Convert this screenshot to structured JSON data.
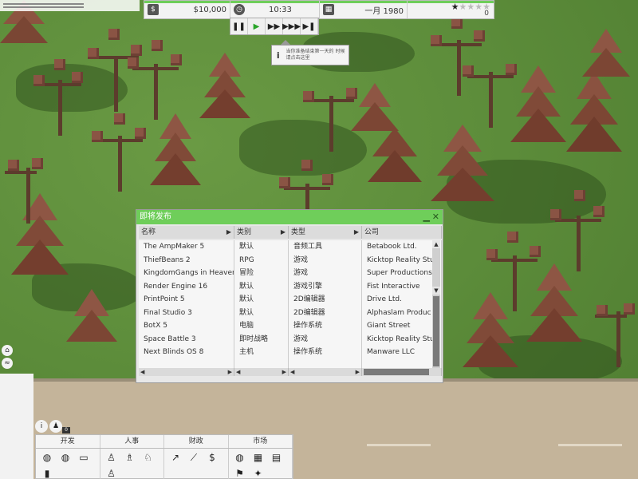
{
  "hud": {
    "money": "$10,000",
    "time": "10:33",
    "date": "一月 1980",
    "star_count": "0",
    "stars_filled": 1,
    "stars_total": 5,
    "icons": {
      "money": "money-icon",
      "clock": "clock-icon",
      "calendar": "calendar-icon",
      "star": "star-icon"
    }
  },
  "speed": {
    "buttons": [
      "pause-icon",
      "play-icon",
      "fast-forward-icon",
      "faster-forward-icon",
      "skip-icon"
    ],
    "glyphs": [
      "❚❚",
      "▶",
      "▶▶",
      "▶▶▶",
      "▶❚"
    ]
  },
  "tooltip": {
    "icon": "i",
    "text": "当你准备结束第一天的 时候请点击这里"
  },
  "releases_window": {
    "title": "即将发布",
    "min_icon": "minimize-icon",
    "close_icon": "close-icon",
    "columns": [
      "名称",
      "类别",
      "类型",
      "公司"
    ],
    "rows": [
      {
        "name": "The AmpMaker 5",
        "category": "默认",
        "type": "音频工具",
        "company": "Betabook Ltd."
      },
      {
        "name": "ThiefBeans 2",
        "category": "RPG",
        "type": "游戏",
        "company": "Kicktop Reality Stu"
      },
      {
        "name": "KingdomGangs in Heaven",
        "category": "冒险",
        "type": "游戏",
        "company": "Super Productions"
      },
      {
        "name": "Render Engine 16",
        "category": "默认",
        "type": "游戏引擎",
        "company": "Fist Interactive"
      },
      {
        "name": "PrintPoint 5",
        "category": "默认",
        "type": "2D编辑器",
        "company": "Drive Ltd."
      },
      {
        "name": "Final Studio 3",
        "category": "默认",
        "type": "2D编辑器",
        "company": "Alphaslam Produc"
      },
      {
        "name": "BotX 5",
        "category": "电脑",
        "type": "操作系统",
        "company": "Giant Street"
      },
      {
        "name": "Space Battle 3",
        "category": "即时战略",
        "type": "游戏",
        "company": "Kicktop Reality Stu"
      },
      {
        "name": "Next Blinds OS 8",
        "category": "主机",
        "type": "操作系统",
        "company": "Manware LLC"
      }
    ]
  },
  "toolbar": {
    "tabs": [
      "开发",
      "人事",
      "财政",
      "市场"
    ],
    "groups": [
      [
        "globe-icon",
        "globe-icon",
        "computer-icon",
        "server-icon"
      ],
      [
        "person-icon",
        "people-icon",
        "group-icon",
        "person-add-icon"
      ],
      [
        "trend-up-icon",
        "line-chart-icon",
        "dollar-icon"
      ],
      [
        "world-icon",
        "grid-icon",
        "newspaper-icon",
        "flag-icon",
        "award-icon"
      ]
    ],
    "glyphs": [
      [
        "◍",
        "◍",
        "▭",
        "▮"
      ],
      [
        "♙",
        "♗",
        "♘",
        "♙"
      ],
      [
        "↗",
        "⟋",
        "$"
      ],
      [
        "◍",
        "▦",
        "▤",
        "⚑",
        "✦"
      ]
    ]
  },
  "side": {
    "icons": [
      "house-icon",
      "chart-icon"
    ],
    "glyphs": [
      "⌂",
      "≈"
    ]
  },
  "small_icons": {
    "info_glyph": "i",
    "person_glyph": "♟",
    "badge": "0"
  }
}
